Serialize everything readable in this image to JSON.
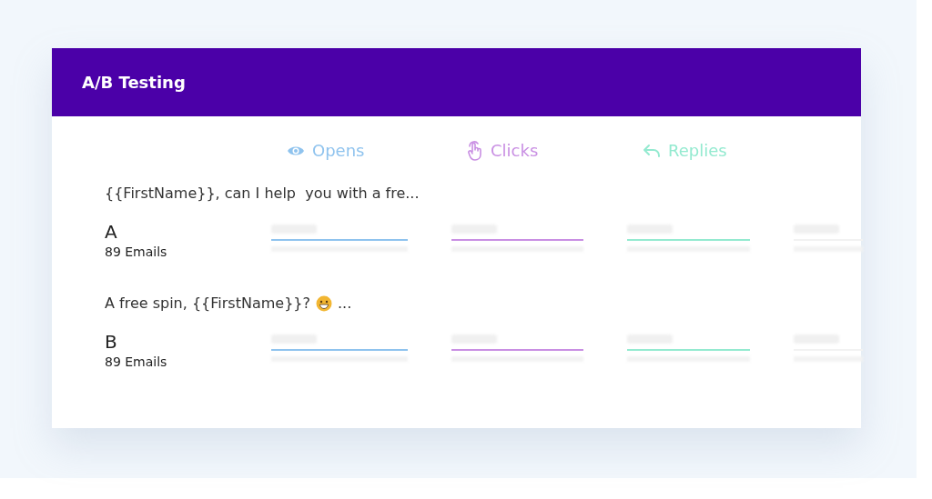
{
  "title": "A/B Testing",
  "metrics": [
    {
      "label": "Opens",
      "kind": "eye",
      "color": "#8fc3ee"
    },
    {
      "label": "Clicks",
      "kind": "hand",
      "color": "#c98fe3"
    },
    {
      "label": "Replies",
      "kind": "reply",
      "color": "#94ead0"
    }
  ],
  "variants": [
    {
      "subject": "{{FirstName}}, can I help  you with a fre...",
      "emoji": false,
      "label": "A",
      "emails": "89 Emails"
    },
    {
      "subject": "A free spin, {{FirstName}}?",
      "emoji": true,
      "trailing": "...",
      "label": "B",
      "emails": "89 Emails"
    }
  ]
}
